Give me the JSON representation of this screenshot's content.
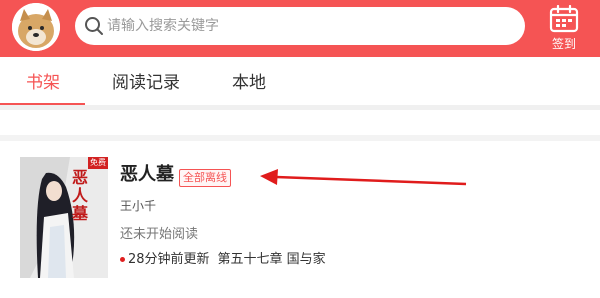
{
  "header": {
    "search_placeholder": "请输入搜索关键字",
    "checkin_label": "签到",
    "accent_color": "#f55454"
  },
  "tabs": [
    {
      "label": "书架",
      "active": true
    },
    {
      "label": "阅读记录",
      "active": false
    },
    {
      "label": "本地",
      "active": false
    }
  ],
  "book": {
    "cover_badge": "免费",
    "cover_title": "恶人墓",
    "title": "恶人墓",
    "status_badge": "全部离线",
    "author": "王小千",
    "reading_status": "还未开始阅读",
    "update_time": "28分钟前更新",
    "latest_chapter": "第五十七章 国与家"
  },
  "icons": [
    "avatar-dog",
    "search-icon",
    "calendar-icon",
    "arrow-annotation"
  ]
}
